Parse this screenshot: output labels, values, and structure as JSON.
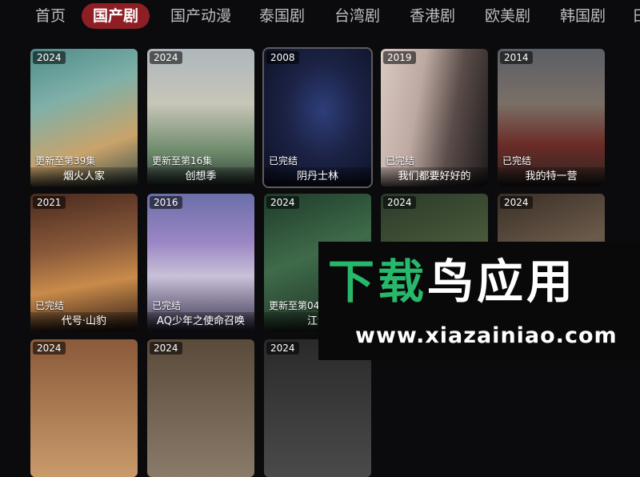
{
  "nav": {
    "tabs": [
      {
        "label": "首页"
      },
      {
        "label": "国产剧"
      },
      {
        "label": "国产动漫"
      },
      {
        "label": "泰国剧"
      },
      {
        "label": "台湾剧"
      },
      {
        "label": "香港剧"
      },
      {
        "label": "欧美剧"
      },
      {
        "label": "韩国剧"
      },
      {
        "label": "日"
      }
    ],
    "active_index": 1
  },
  "cards": [
    {
      "year": "2024",
      "status": "更新至第39集",
      "title": "烟火人家"
    },
    {
      "year": "2024",
      "status": "更新至第16集",
      "title": "创想季"
    },
    {
      "year": "2008",
      "status": "已完结",
      "title": "阴丹士林"
    },
    {
      "year": "2019",
      "status": "已完结",
      "title": "我们都要好好的"
    },
    {
      "year": "2014",
      "status": "已完结",
      "title": "我的特一营"
    },
    {
      "year": "2021",
      "status": "已完结",
      "title": "代号·山豹"
    },
    {
      "year": "2016",
      "status": "已完结",
      "title": "AQ少年之使命召唤"
    },
    {
      "year": "2024",
      "status": "更新至第04",
      "title": "江河"
    },
    {
      "year": "2024",
      "status": "",
      "title": ""
    },
    {
      "year": "2024",
      "status": "",
      "title": ""
    },
    {
      "year": "2024",
      "status": "",
      "title": ""
    },
    {
      "year": "2024",
      "status": "",
      "title": ""
    },
    {
      "year": "2024",
      "status": "",
      "title": ""
    }
  ],
  "watermark": {
    "logo_part1": "下载",
    "logo_part2": "鸟",
    "logo_part3": "应用",
    "url": "www.xiazainiao.com"
  },
  "colors": {
    "background": "#0b0b0d",
    "active_tab": "#8e1e24",
    "watermark_green": "#27b86b"
  }
}
